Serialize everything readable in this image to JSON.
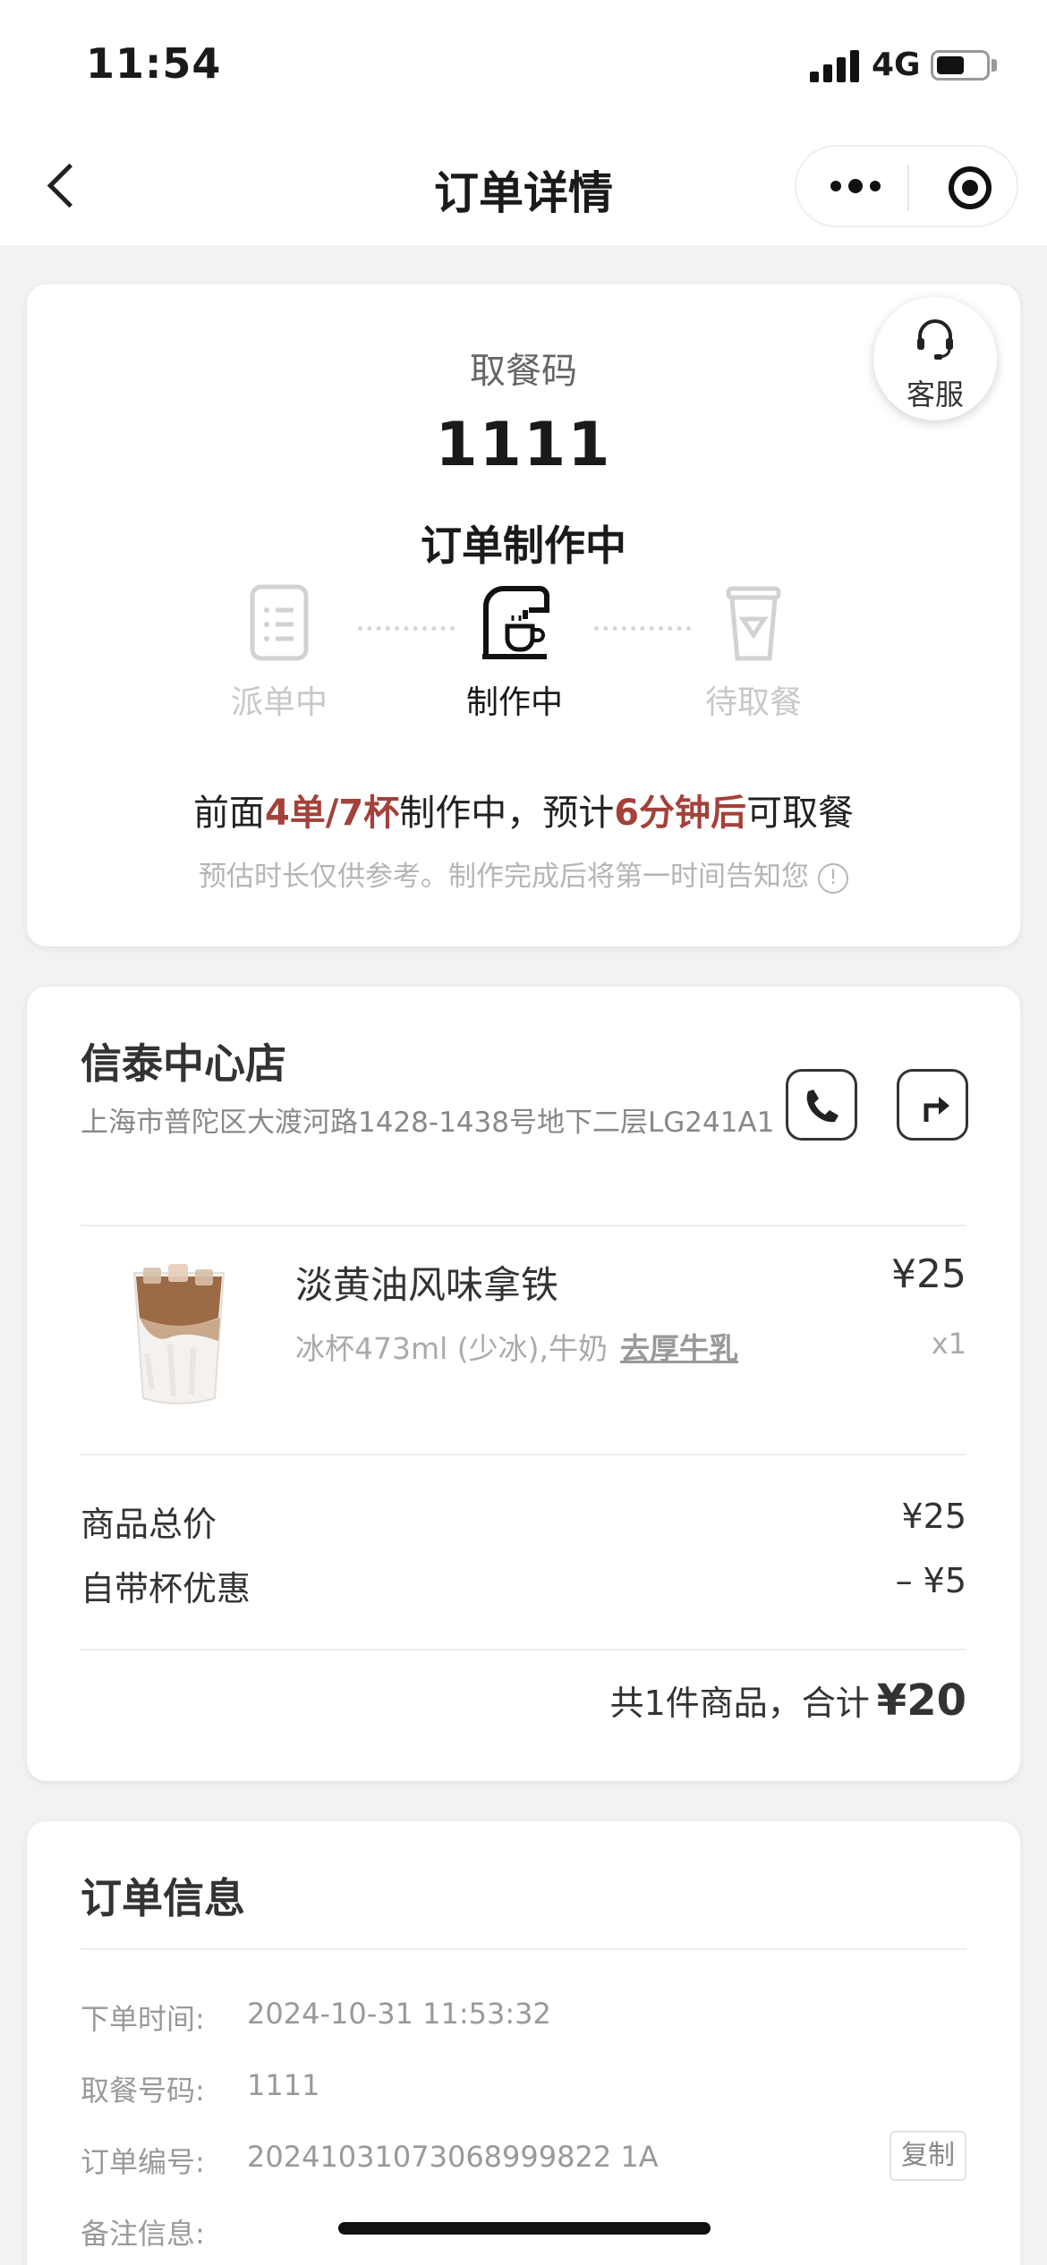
{
  "status_bar": {
    "time": "11:54",
    "network": "4G"
  },
  "nav": {
    "title": "订单详情"
  },
  "pickup": {
    "label": "取餐码",
    "code": "1111",
    "status": "订单制作中",
    "support_label": "客服",
    "steps": [
      {
        "label": "派单中",
        "icon": "clipboard-icon",
        "active": false
      },
      {
        "label": "制作中",
        "icon": "coffee-machine-icon",
        "active": true
      },
      {
        "label": "待取餐",
        "icon": "cup-icon",
        "active": false
      }
    ],
    "queue": {
      "prefix": "前面",
      "count": "4单/7杯",
      "middle": "制作中，预计",
      "eta": "6分钟后",
      "suffix": "可取餐"
    },
    "note": "预估时长仅供参考。制作完成后将第一时间告知您"
  },
  "store": {
    "name": "信泰中心店",
    "address": "上海市普陀区大渡河路1428-1438号地下二层LG241A1"
  },
  "item": {
    "name": "淡黄油风味拿铁",
    "price": "¥25",
    "spec": "冰杯473ml (少冰),牛奶",
    "spec_highlight": "去厚牛乳",
    "qty": "x1"
  },
  "summary": {
    "subtotal_label": "商品总价",
    "subtotal_value": "¥25",
    "discount_label": "自带杯优惠",
    "discount_value": "– ¥5",
    "total_prefix": "共1件商品，合计",
    "total_amount": "¥20"
  },
  "order_info": {
    "title": "订单信息",
    "rows": [
      {
        "key": "下单时间:",
        "value": "2024-10-31 11:53:32"
      },
      {
        "key": "取餐号码:",
        "value": "1111"
      },
      {
        "key": "订单编号:",
        "value": "20241031073068999822 1A"
      },
      {
        "key": "备注信息:",
        "value": ""
      }
    ],
    "copy_label": "复制"
  }
}
